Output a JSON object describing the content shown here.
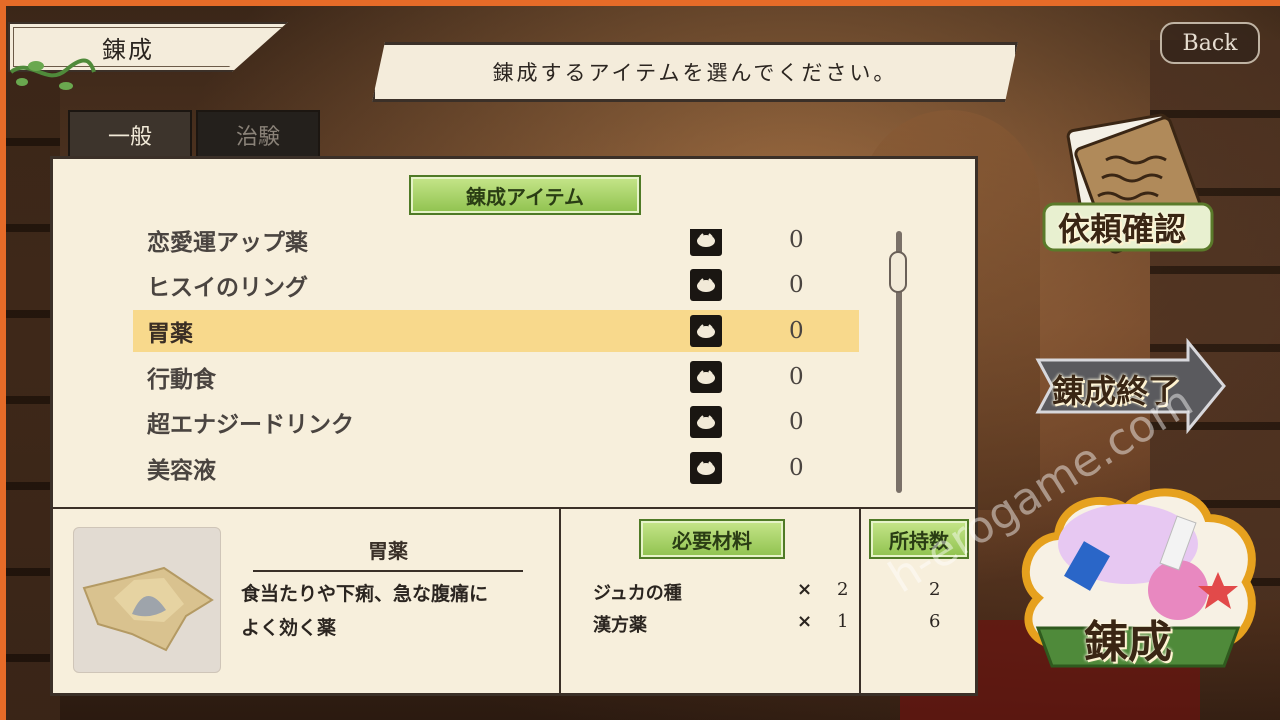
{
  "screen": {
    "title": "錬成",
    "instruction": "錬成するアイテムを選んでください。",
    "back_label": "Back"
  },
  "tabs": [
    {
      "label": "一般",
      "active": true
    },
    {
      "label": "治験",
      "active": false
    }
  ],
  "list": {
    "header": "錬成アイテム",
    "items": [
      {
        "name": "恋愛運アップ薬",
        "count": "0",
        "selected": false
      },
      {
        "name": "ヒスイのリング",
        "count": "0",
        "selected": false
      },
      {
        "name": "胃薬",
        "count": "0",
        "selected": true
      },
      {
        "name": "行動食",
        "count": "0",
        "selected": false
      },
      {
        "name": "超エナジードリンク",
        "count": "0",
        "selected": false
      },
      {
        "name": "美容液",
        "count": "0",
        "selected": false
      }
    ]
  },
  "detail": {
    "name": "胃薬",
    "description_line1": "食当たりや下痢、急な腹痛に",
    "description_line2": "よく効く薬"
  },
  "materials": {
    "header": "必要材料",
    "owned_header": "所持数",
    "rows": [
      {
        "name": "ジュカの種",
        "times": "×",
        "qty": "2",
        "owned": "2"
      },
      {
        "name": "漢方薬",
        "times": "×",
        "qty": "1",
        "owned": "6"
      }
    ]
  },
  "actions": {
    "request_label": "依頼確認",
    "end_label": "錬成終了",
    "craft_label": "錬成"
  },
  "watermark": "h-erogame.com",
  "colors": {
    "selected_row": "#f8d98c",
    "green_label": "#8fc24e",
    "panel_bg": "#f7efdc",
    "accent_edge": "#e66b28"
  }
}
